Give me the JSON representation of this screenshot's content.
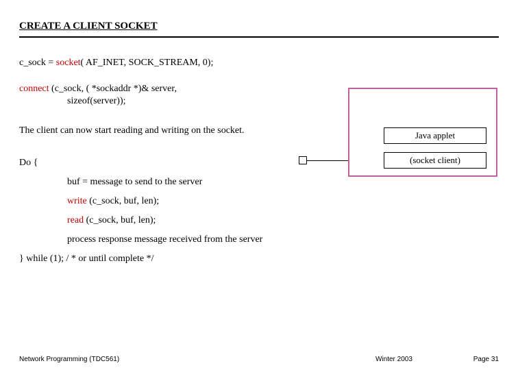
{
  "title": "CREATE A CLIENT SOCKET",
  "socket_line": {
    "prefix": "c_sock = ",
    "kw": "socket",
    "rest": "( AF_INET, SOCK_STREAM, 0);"
  },
  "connect_line": {
    "kw": "connect ",
    "rest1": "(c_sock, ( *sockaddr *)& server,",
    "rest2": "sizeof(server));"
  },
  "client_text": "The client can now start reading and writing on the socket.",
  "diagram": {
    "box1": "Java applet",
    "box2": "(socket client)"
  },
  "do_label": "Do {",
  "do_items": {
    "buf": "buf = message to send to the server",
    "write_kw": "write ",
    "write_rest": "(c_sock, buf, len);",
    "read_kw": "read ",
    "read_rest": "(c_sock, buf, len);",
    "process": "process response message received from the server"
  },
  "while_line": "} while (1);  / * or until complete */",
  "footer": {
    "left": "Network Programming (TDC561)",
    "center": "Winter  2003",
    "right": "Page 31"
  }
}
